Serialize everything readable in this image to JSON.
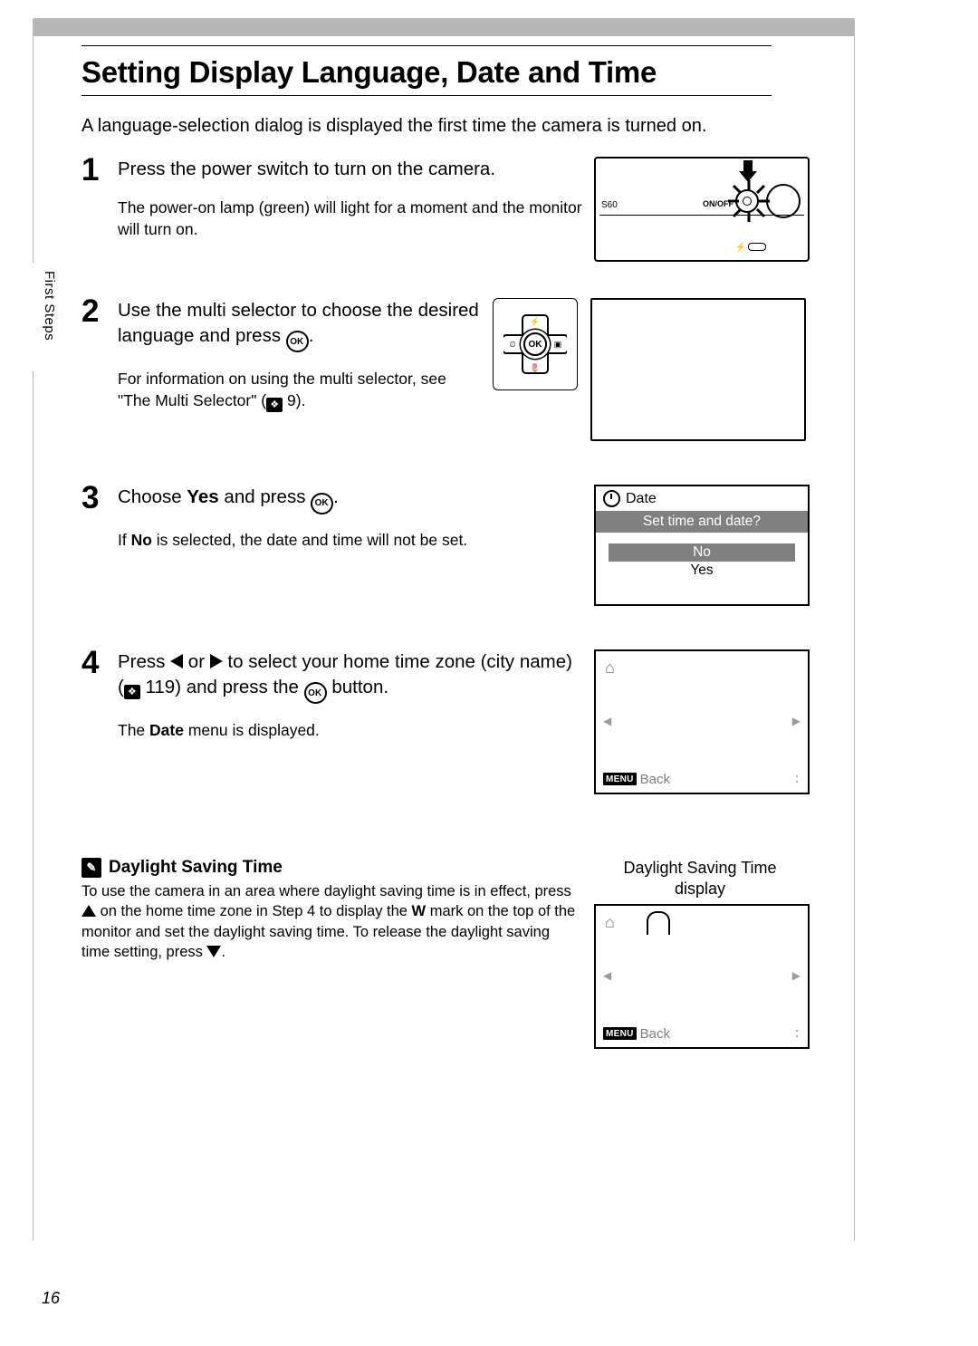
{
  "section_label": "First Steps",
  "page_number": "16",
  "title": "Setting Display Language, Date and Time",
  "intro": "A language-selection dialog is displayed the first time the camera is turned on.",
  "steps": {
    "s1": {
      "num": "1",
      "head": "Press the power switch to turn on the camera.",
      "sub": "The power-on lamp (green) will light for a moment and the monitor will turn on.",
      "cam": {
        "label_560": "S60",
        "label_onoff": "ON/OFF"
      }
    },
    "s2": {
      "num": "2",
      "head_a": "Use the multi selector to choose the desired language and press ",
      "head_b": ".",
      "sub_a": "For information on using the multi selector, see \"The Multi Selector\" (",
      "sub_ref": "9",
      "sub_b": ").",
      "ok_text": "OK"
    },
    "s3": {
      "num": "3",
      "head_a": "Choose ",
      "head_bold": "Yes",
      "head_b": " and press ",
      "head_c": ".",
      "sub_a": "If ",
      "sub_bold": "No",
      "sub_b": " is selected, the date and time will not be set.",
      "dialog": {
        "title": "Date",
        "question": "Set time and date?",
        "opt_no": "No",
        "opt_yes": "Yes"
      }
    },
    "s4": {
      "num": "4",
      "head_a": "Press ",
      "head_b": " or ",
      "head_c": " to select your home time zone (city name) (",
      "head_ref": "119",
      "head_d": ") and press the ",
      "head_e": " button.",
      "sub_a": "The ",
      "sub_bold": "Date",
      "sub_b": " menu is displayed.",
      "screen": {
        "menu": "MENU",
        "back": "Back"
      }
    }
  },
  "dst": {
    "title": "Daylight Saving Time",
    "body_a": "To use the camera in an area where daylight saving time is in effect, press ",
    "body_b": " on the home time zone in Step 4 to display the ",
    "body_mark": "W",
    "body_c": " mark on the top of the monitor and set the daylight saving time. To release the daylight saving time setting, press ",
    "body_d": ".",
    "caption_a": "Daylight Saving Time",
    "caption_b": "display",
    "screen": {
      "menu": "MENU",
      "back": "Back"
    }
  }
}
